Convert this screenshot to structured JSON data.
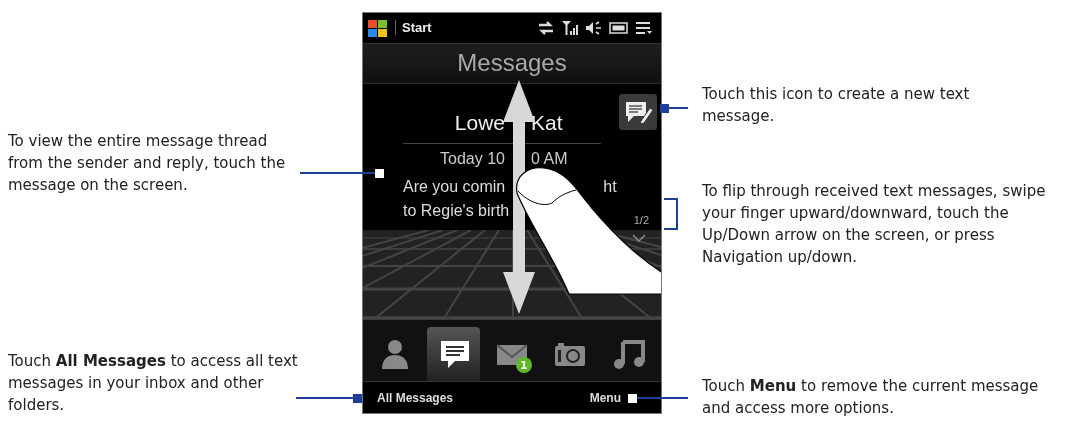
{
  "phone": {
    "status_bar": {
      "start_label": "Start"
    },
    "title": "Messages",
    "message": {
      "sender_parts": [
        "Lowe",
        "Kat"
      ],
      "time_parts": [
        "Today 10",
        "0 AM"
      ],
      "line_1_parts": [
        "Are you comin",
        "ht"
      ],
      "line_2": "to Regie's birth",
      "pager": "1/2"
    },
    "tabs": [
      {
        "kind": "contact",
        "selected": false
      },
      {
        "kind": "messages",
        "selected": true
      },
      {
        "kind": "mail",
        "selected": false,
        "badge": "1"
      },
      {
        "kind": "camera",
        "selected": false
      },
      {
        "kind": "music",
        "selected": false
      }
    ],
    "soft_keys": {
      "left": "All Messages",
      "right": "Menu"
    }
  },
  "callouts": [
    {
      "kind": "line",
      "text": "To view the entire message thread from the sender and reply, touch the message on the screen."
    },
    {
      "kind": "line",
      "text": "Touch **All Messages** to access all text messages in your inbox and other folders."
    },
    {
      "kind": "line",
      "text": "Touch this icon to create a new text message."
    },
    {
      "kind": "bracket",
      "text": "To flip through received text messages, swipe your finger upward/downward, touch the Up/Down arrow on the screen, or press Navigation up/down."
    },
    {
      "kind": "line",
      "text": "Touch **Menu** to remove the current message and access more options."
    }
  ]
}
